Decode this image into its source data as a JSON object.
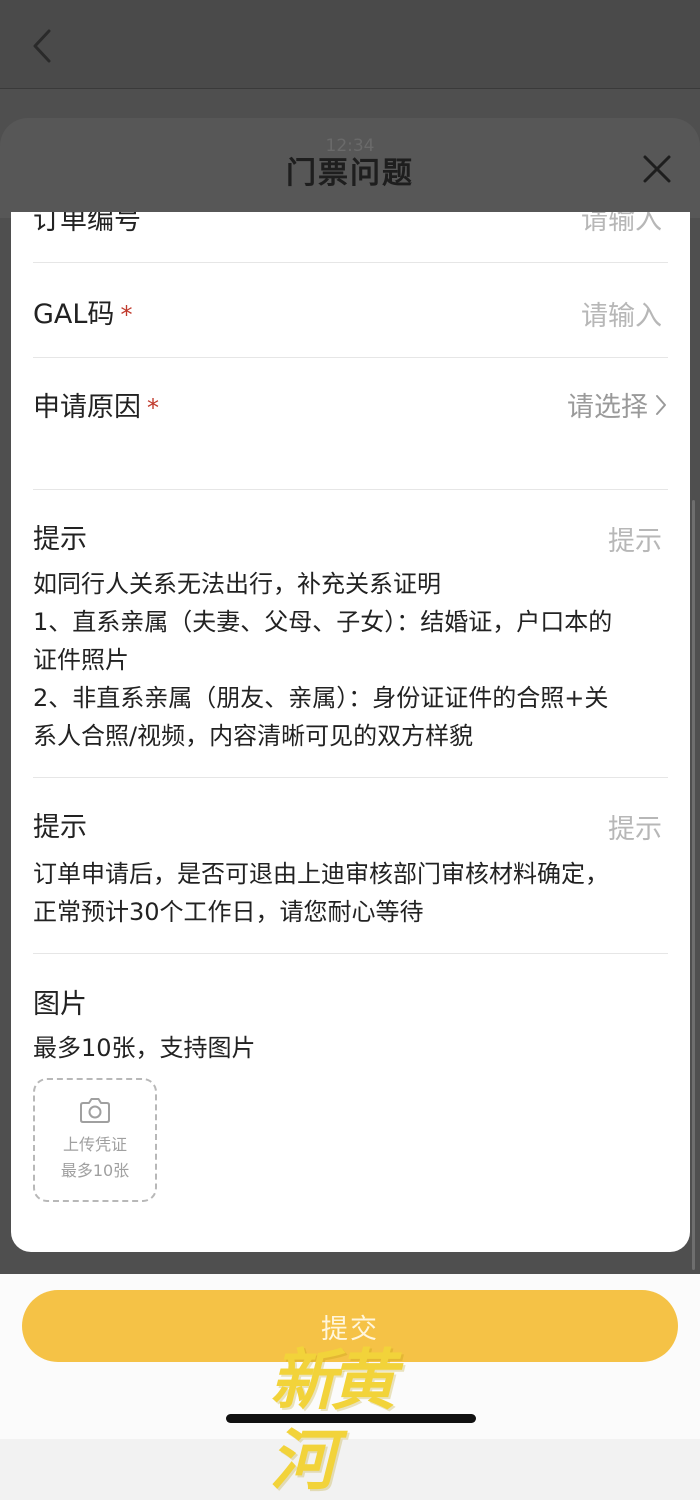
{
  "sheet": {
    "time": "12:34",
    "title": "门票问题"
  },
  "form": {
    "order_number": {
      "label": "订单编号",
      "placeholder": "请输入"
    },
    "gal_code": {
      "label": "GAL码",
      "required_mark": "*",
      "placeholder": "请输入"
    },
    "apply_reason": {
      "label": "申请原因",
      "required_mark": "*",
      "value": "请选择"
    },
    "tip1": {
      "label": "提示",
      "right": "提示",
      "lines": [
        "如同行人关系无法出行，补充关系证明",
        "1、直系亲属（夫妻、父母、子女）：结婚证，户口本的",
        "证件照片",
        "2、非直系亲属（朋友、亲属）：身份证证件的合照+关",
        "系人合照/视频，内容清晰可见的双方样貌"
      ]
    },
    "tip2": {
      "label": "提示",
      "right": "提示",
      "lines": [
        "订单申请后，是否可退由上迪审核部门审核材料确定，",
        "正常预计30个工作日，请您耐心等待"
      ]
    },
    "images": {
      "label": "图片",
      "hint": "最多10张，支持图片",
      "upload_line1": "上传凭证",
      "upload_line2": "最多10张"
    }
  },
  "submit_label": "提交",
  "watermark_text": "新黄河",
  "icons": {
    "back": "chevron-left-icon",
    "close": "close-icon",
    "chevron": "chevron-right-icon",
    "camera": "camera-icon"
  },
  "colors": {
    "accent": "#f5c246",
    "required": "#c0392b"
  }
}
